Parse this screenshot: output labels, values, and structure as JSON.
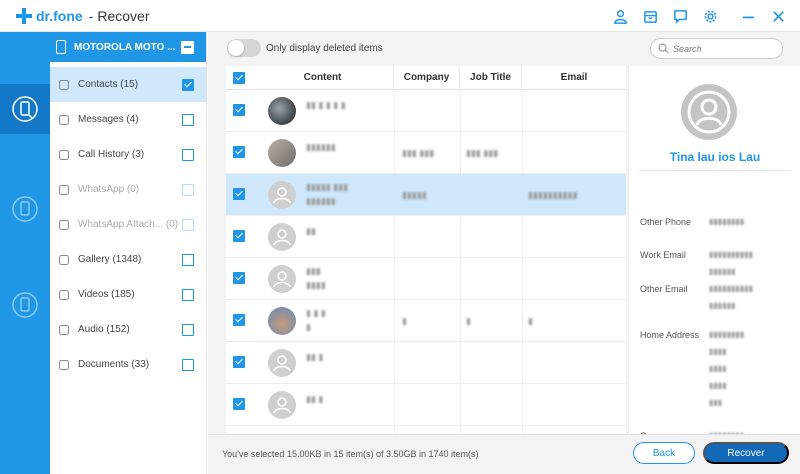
{
  "app": {
    "brand": "dr.fone",
    "separator": "-",
    "title": "Recover"
  },
  "titlebar_icons": [
    "user-icon",
    "cart-icon",
    "chat-icon",
    "gear-icon",
    "minimize-icon",
    "close-icon"
  ],
  "device": {
    "name": "MOTOROLA MOTO ..."
  },
  "categories": [
    {
      "label": "Contacts (15)",
      "checked": true,
      "active": true
    },
    {
      "label": "Messages (4)",
      "checked": false
    },
    {
      "label": "Call History (3)",
      "checked": false
    },
    {
      "label": "WhatsApp (0)",
      "checked": false,
      "disabled": true
    },
    {
      "label": "WhatsApp Attach... (0)",
      "checked": false,
      "disabled": true
    },
    {
      "label": "Gallery (1348)",
      "checked": false
    },
    {
      "label": "Videos (185)",
      "checked": false
    },
    {
      "label": "Audio (152)",
      "checked": false
    },
    {
      "label": "Documents (33)",
      "checked": false
    }
  ],
  "toolbar": {
    "toggle_label": "Only display deleted items",
    "search_placeholder": "Search"
  },
  "table": {
    "headers": {
      "content": "Content",
      "company": "Company",
      "job_title": "Job Title",
      "email": "Email"
    },
    "rows": [
      {
        "line1": "▮▮ ▮ ▮ ▮ ▮",
        "line2": "",
        "company": "",
        "job": "",
        "email": ""
      },
      {
        "line1": "▮▮▮▮▮▮",
        "line2": "",
        "company": "▮▮▮ ▮▮▮",
        "job": "▮▮▮ ▮▮▮",
        "email": ""
      },
      {
        "line1": "▮▮▮▮▮ ▮▮▮",
        "line2": "▮▮▮▮▮▮",
        "company": "▮▮▮▮▮",
        "job": "",
        "email": "▮▮▮▮▮▮▮▮▮▮"
      },
      {
        "line1": "▮▮",
        "line2": "",
        "company": "",
        "job": "",
        "email": ""
      },
      {
        "line1": "▮▮▮",
        "line2": "▮▮▮▮",
        "company": "",
        "job": "",
        "email": ""
      },
      {
        "line1": "▮ ▮ ▮",
        "line2": "▮",
        "company": "▮",
        "job": "▮",
        "email": "▮"
      },
      {
        "line1": "▮▮ ▮",
        "line2": "",
        "company": "",
        "job": "",
        "email": ""
      },
      {
        "line1": "▮▮ ▮",
        "line2": "",
        "company": "",
        "job": "",
        "email": ""
      }
    ]
  },
  "detail": {
    "name": "Tina lau ios Lau",
    "fields": [
      {
        "label": "Other Phone",
        "values": [
          "▮▮▮▮▮▮▮▮"
        ]
      },
      {
        "label": "Work Email",
        "values": [
          "▮▮▮▮▮▮▮▮▮▮",
          "▮▮▮▮▮▮"
        ]
      },
      {
        "label": "Other Email",
        "values": [
          "▮▮▮▮▮▮▮▮▮▮",
          "▮▮▮▮▮▮"
        ]
      },
      {
        "label": "Home Address",
        "values": [
          "▮▮▮▮▮▮▮▮",
          "▮▮▮▮",
          "▮▮▮▮",
          "▮▮▮▮",
          "▮▮▮"
        ]
      },
      {
        "label": "Company",
        "values": [
          "▮▮▮▮▮▮▮▮"
        ]
      }
    ]
  },
  "footer": {
    "status": "You've selected 15.00KB in 15 item(s) of 3.50GB in 1740 item(s)",
    "back": "Back",
    "recover": "Recover"
  }
}
